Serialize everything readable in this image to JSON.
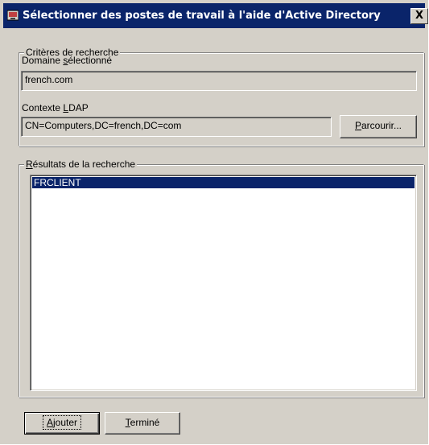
{
  "window": {
    "title": "Sélectionner des postes de travail à l'aide d'Active Directory",
    "close_label": "X"
  },
  "search_criteria": {
    "legend": "Critères de recherche",
    "domain_label_pre": "Domaine ",
    "domain_label_key": "s",
    "domain_label_post": "électionné",
    "domain_value": "french.com",
    "ldap_label_pre": "Contexte ",
    "ldap_label_key": "L",
    "ldap_label_post": "DAP",
    "ldap_value": "CN=Computers,DC=french,DC=com",
    "browse_key": "P",
    "browse_rest": "arcourir..."
  },
  "results": {
    "legend_key": "R",
    "legend_rest": "ésultats de la recherche",
    "items": [
      "FRCLIENT"
    ]
  },
  "buttons": {
    "add_key": "A",
    "add_rest": "jouter",
    "done_key": "T",
    "done_rest": "erminé"
  },
  "colors": {
    "face": "#d4d0c8",
    "titlebar": "#0a246a",
    "selection": "#0a246a"
  }
}
